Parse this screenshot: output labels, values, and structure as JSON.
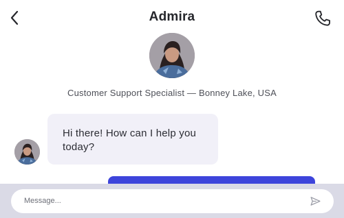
{
  "header": {
    "title": "Admira",
    "back_icon": "chevron-left-icon",
    "call_icon": "phone-icon"
  },
  "profile": {
    "subtitle": "Customer Support Specialist — Bonney Lake, USA"
  },
  "messages": [
    {
      "sender": "agent",
      "text": "Hi there! How can I help you today?"
    }
  ],
  "composer": {
    "placeholder": "Message...",
    "send_icon": "send-icon"
  },
  "colors": {
    "accent": "#3d44db",
    "incoming_bubble": "#f1f0f8",
    "composer_bar": "#dadae6"
  }
}
